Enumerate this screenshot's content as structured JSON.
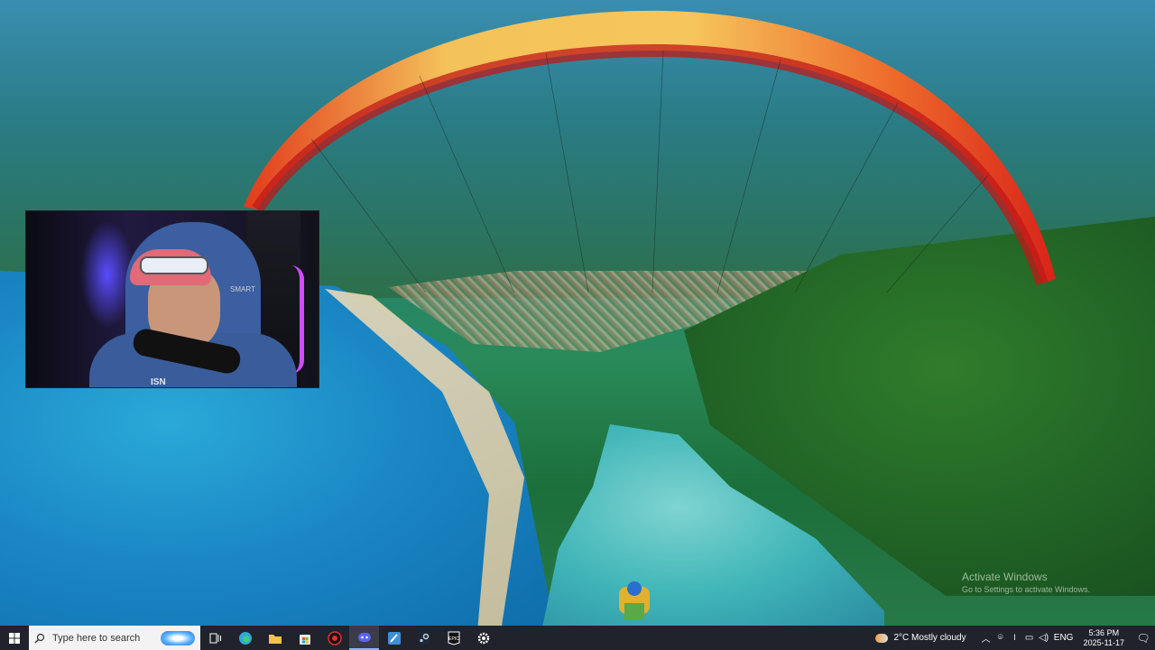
{
  "desktop": {
    "wallpaper": "paraglider-over-lagoon",
    "watermark": {
      "title": "Activate Windows",
      "subtitle": "Go to Settings to activate Windows."
    }
  },
  "webcam": {
    "label": "webcam-overlay",
    "chair_text": "SMART",
    "shirt_text": "ISN"
  },
  "taskbar": {
    "search_placeholder": "Type here to search",
    "apps": [
      {
        "name": "task-view",
        "icon": "task-view-icon",
        "color": "#ffffff"
      },
      {
        "name": "edge",
        "icon": "edge-icon",
        "color": "#2fa8d8"
      },
      {
        "name": "file-explorer",
        "icon": "folder-icon",
        "color": "#f2c14e"
      },
      {
        "name": "store",
        "icon": "store-icon",
        "color": "#3a7bd5"
      },
      {
        "name": "recorder",
        "icon": "record-icon",
        "color": "#e03030"
      },
      {
        "name": "discord",
        "icon": "discord-icon",
        "color": "#5865f2",
        "active": true
      },
      {
        "name": "paint",
        "icon": "paint-icon",
        "color": "#3f8fd8"
      },
      {
        "name": "steam",
        "icon": "steam-icon",
        "color": "#c7d5e0"
      },
      {
        "name": "epic-games",
        "icon": "epic-icon",
        "color": "#ffffff"
      },
      {
        "name": "settings",
        "icon": "gear-icon",
        "color": "#ffffff"
      }
    ],
    "weather": "2°C  Mostly cloudy",
    "language": "ENG",
    "time": "5:36 PM",
    "date": "2025-11-17"
  }
}
